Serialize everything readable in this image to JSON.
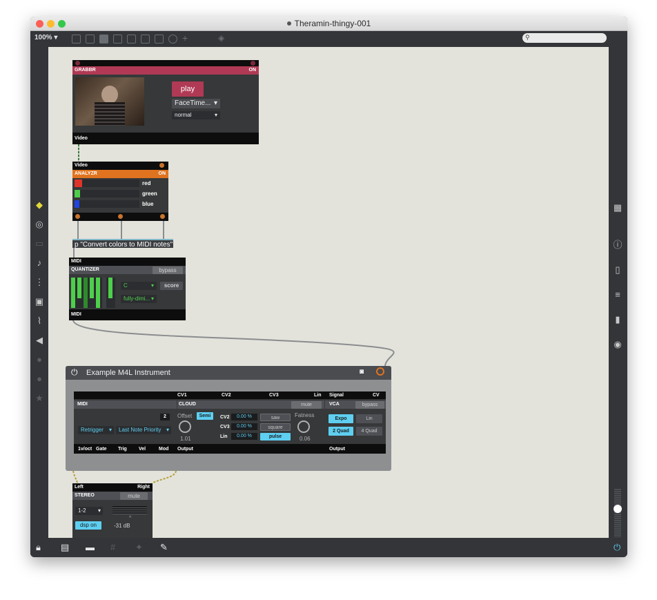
{
  "window": {
    "title": "Theramin-thingy-001"
  },
  "toolbar": {
    "zoom": "100% ▾"
  },
  "grabbr": {
    "header": "GRABBR",
    "on": "ON",
    "play": "play",
    "camera": "FaceTime...",
    "mode": "normal",
    "footer": "Video"
  },
  "analyzr": {
    "input": "Video",
    "header": "ANALYZR",
    "on": "ON",
    "channels": [
      {
        "label": "red",
        "color": "#e0342a",
        "level": 0.12
      },
      {
        "label": "green",
        "color": "#4ecf4b",
        "level": 0.08
      },
      {
        "label": "blue",
        "color": "#2045e0",
        "level": 0.07
      }
    ]
  },
  "subpatch": {
    "label": "p \"Convert colors to MIDI notes\""
  },
  "quantizer": {
    "input": "MIDI",
    "header": "QUANTIZER",
    "bypass": "bypass",
    "key": "C",
    "score": "score",
    "scale": "fully-dimi...",
    "footer": "MIDI"
  },
  "instrument": {
    "title": "Example M4L Instrument",
    "top_labels": {
      "cv1": "CV1",
      "cv2": "CV2",
      "cv3": "CV3",
      "lin": "Lin",
      "signal": "Signal",
      "cv": "CV"
    },
    "midi": {
      "header": "MIDI",
      "voices": "2",
      "retrigger": "Retrigger",
      "priority": "Last Note Priority"
    },
    "cloud": {
      "header": "CLOUD",
      "mute": "mute",
      "offset": "Offset",
      "semi": "Semi",
      "offset_val": "1.01",
      "rows": [
        {
          "label": "CV2",
          "value": "0.00 %"
        },
        {
          "label": "CV3",
          "value": "0.00 %"
        },
        {
          "label": "Lin",
          "value": "0.00 %"
        }
      ],
      "waves": {
        "saw": "saw",
        "square": "square",
        "pulse": "pulse"
      },
      "fatness": "Fatness",
      "fatness_val": "0.06"
    },
    "vca": {
      "header": "VCA",
      "bypass": "bypass",
      "expo": "Expo",
      "lin": "Lin",
      "quad2": "2 Quad",
      "quad4": "4 Quad"
    },
    "bottom_labels": {
      "octave": "1v/oct",
      "gate": "Gate",
      "trig": "Trig",
      "vel": "Vel",
      "mod": "Mod",
      "output": "Output",
      "output2": "Output"
    }
  },
  "stereo": {
    "left": "Left",
    "right": "Right",
    "header": "STEREO",
    "mute": "mute",
    "channel": "1-2",
    "dsp": "dsp on",
    "db": "-31 dB",
    "marker": "^"
  },
  "sidebar_left": [
    "package-icon",
    "target-icon",
    "window-icon",
    "music-note-icon",
    "step-icon",
    "image-icon",
    "paperclip-icon",
    "plug-icon",
    "p-icon",
    "o-icon",
    "star-icon"
  ],
  "sidebar_right": [
    "grid-icon",
    "info-icon",
    "book-icon",
    "list-icon",
    "books-icon",
    "camera-icon"
  ]
}
